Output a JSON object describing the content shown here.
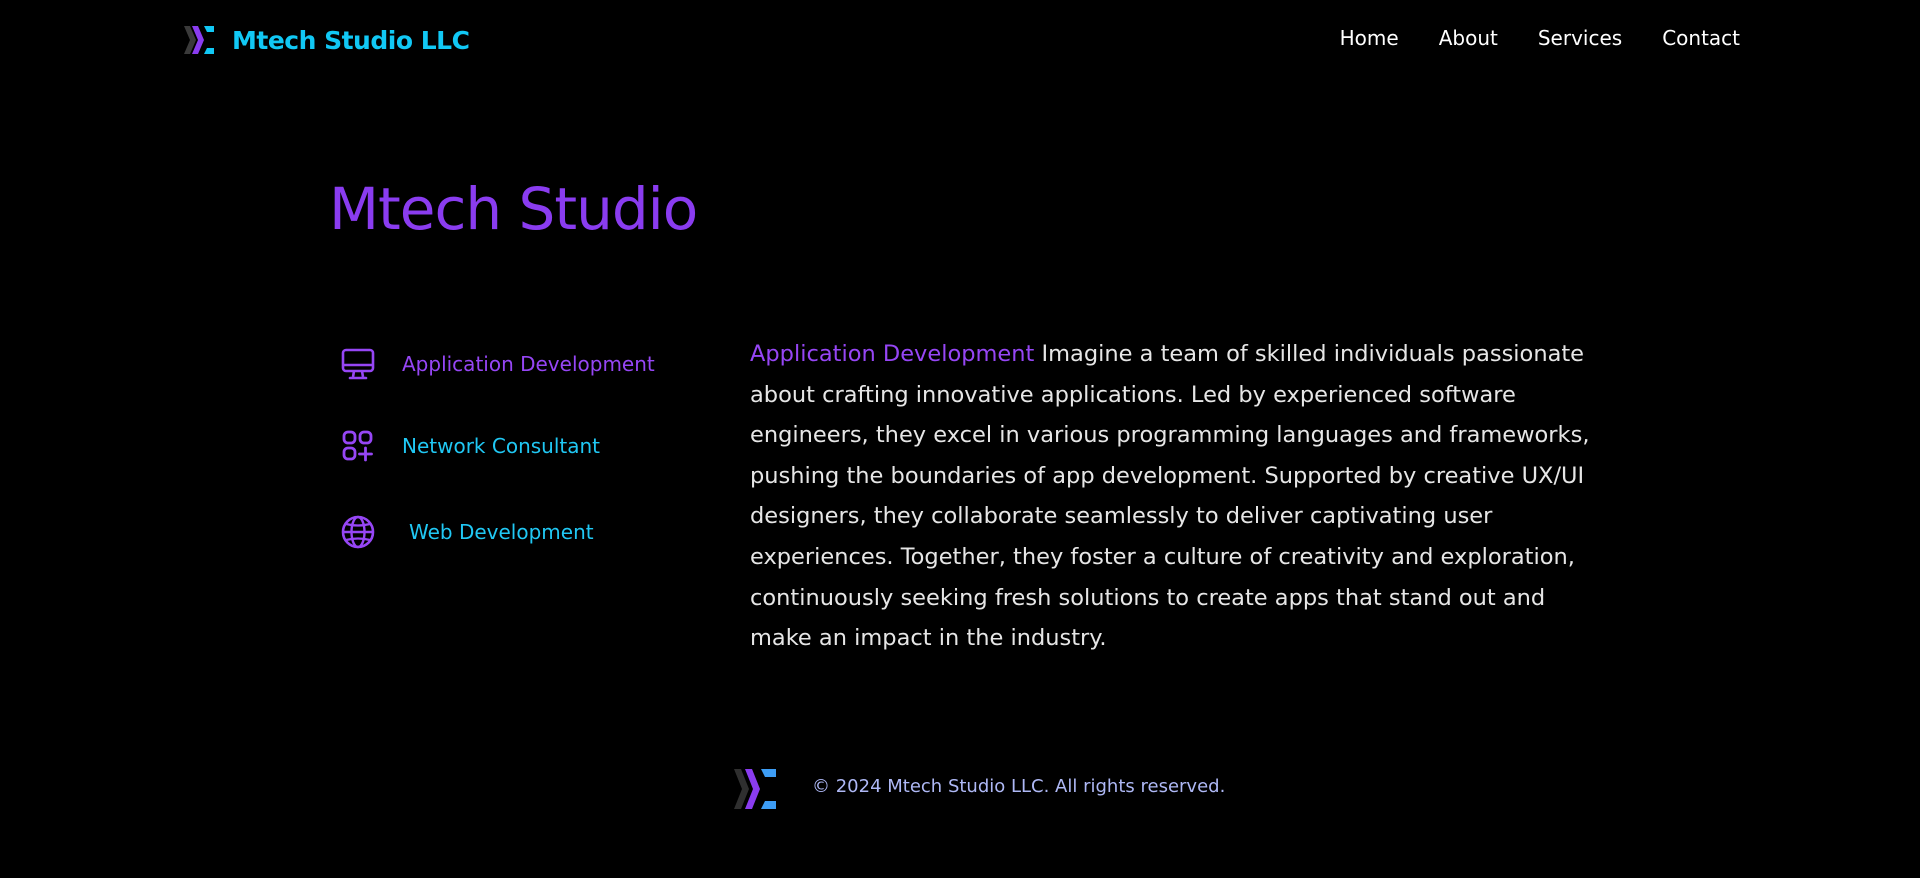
{
  "header": {
    "brand_name": "Mtech Studio LLC",
    "nav": [
      {
        "label": "Home"
      },
      {
        "label": "About"
      },
      {
        "label": "Services"
      },
      {
        "label": "Contact"
      }
    ]
  },
  "main": {
    "title": "Mtech Studio",
    "services": [
      {
        "label": "Application Development",
        "icon": "monitor-icon"
      },
      {
        "label": "Network Consultant",
        "icon": "apps-grid-icon"
      },
      {
        "label": "Web Development",
        "icon": "globe-icon"
      }
    ],
    "description": {
      "highlight": "Application Development",
      "text": "Imagine a team of skilled individuals passionate about crafting innovative applications. Led by experienced software engineers, they excel in various programming languages and frameworks, pushing the boundaries of app development. Supported by creative UX/UI designers, they collaborate seamlessly to deliver captivating user experiences. Together, they foster a culture of creativity and exploration, continuously seeking fresh solutions to create apps that stand out and make an impact in the industry."
    }
  },
  "footer": {
    "copyright": "© 2024 Mtech Studio LLC. All rights reserved."
  },
  "colors": {
    "background": "#000000",
    "brand_cyan": "#11c8f5",
    "accent_purple": "#8a3cf0",
    "service_purple": "#9646f5",
    "footer_text": "#aeb8f5"
  }
}
